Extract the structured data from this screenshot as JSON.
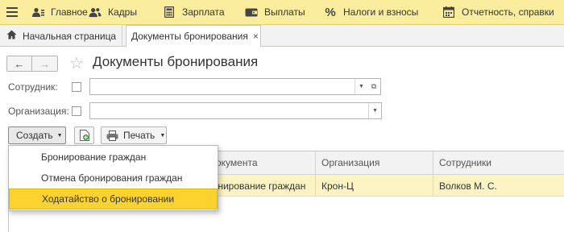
{
  "topbar": {
    "items": [
      {
        "icon": "person-group-icon",
        "label": "Главное"
      },
      {
        "icon": "people-icon",
        "label": "Кадры"
      },
      {
        "icon": "calculator-icon",
        "label": "Зарплата"
      },
      {
        "icon": "wallet-icon",
        "label": "Выплаты"
      },
      {
        "icon": "percent-icon",
        "label": "Налоги и взносы"
      },
      {
        "icon": "report-icon",
        "label": "Отчетность, справки"
      }
    ]
  },
  "tabs": {
    "home": "Начальная страница",
    "active": "Документы бронирования",
    "close_glyph": "×"
  },
  "form": {
    "title": "Документы бронирования",
    "back_glyph": "←",
    "forward_glyph": "→",
    "star_glyph": "☆"
  },
  "filters": {
    "employee_label": "Сотрудник:",
    "employee_value": "",
    "organization_label": "Организация:",
    "organization_value": ""
  },
  "toolbar": {
    "create_label": "Создать",
    "print_label": "Печать"
  },
  "table": {
    "columns": [
      "документа",
      "Организация",
      "Сотрудники"
    ],
    "rows": [
      {
        "doc": "ронирование граждан",
        "org": "Крон-Ц",
        "employees": "Волков М. С."
      }
    ]
  },
  "create_menu": {
    "items": [
      {
        "label": "Бронирование граждан",
        "selected": false
      },
      {
        "label": "Отмена бронирования граждан",
        "selected": false
      },
      {
        "label": "Ходатайство о бронировании",
        "selected": true
      }
    ]
  },
  "colors": {
    "topbar_bg": "#fbed9e",
    "selected_row": "#fcf3c4",
    "menu_highlight": "#fbd22e"
  }
}
